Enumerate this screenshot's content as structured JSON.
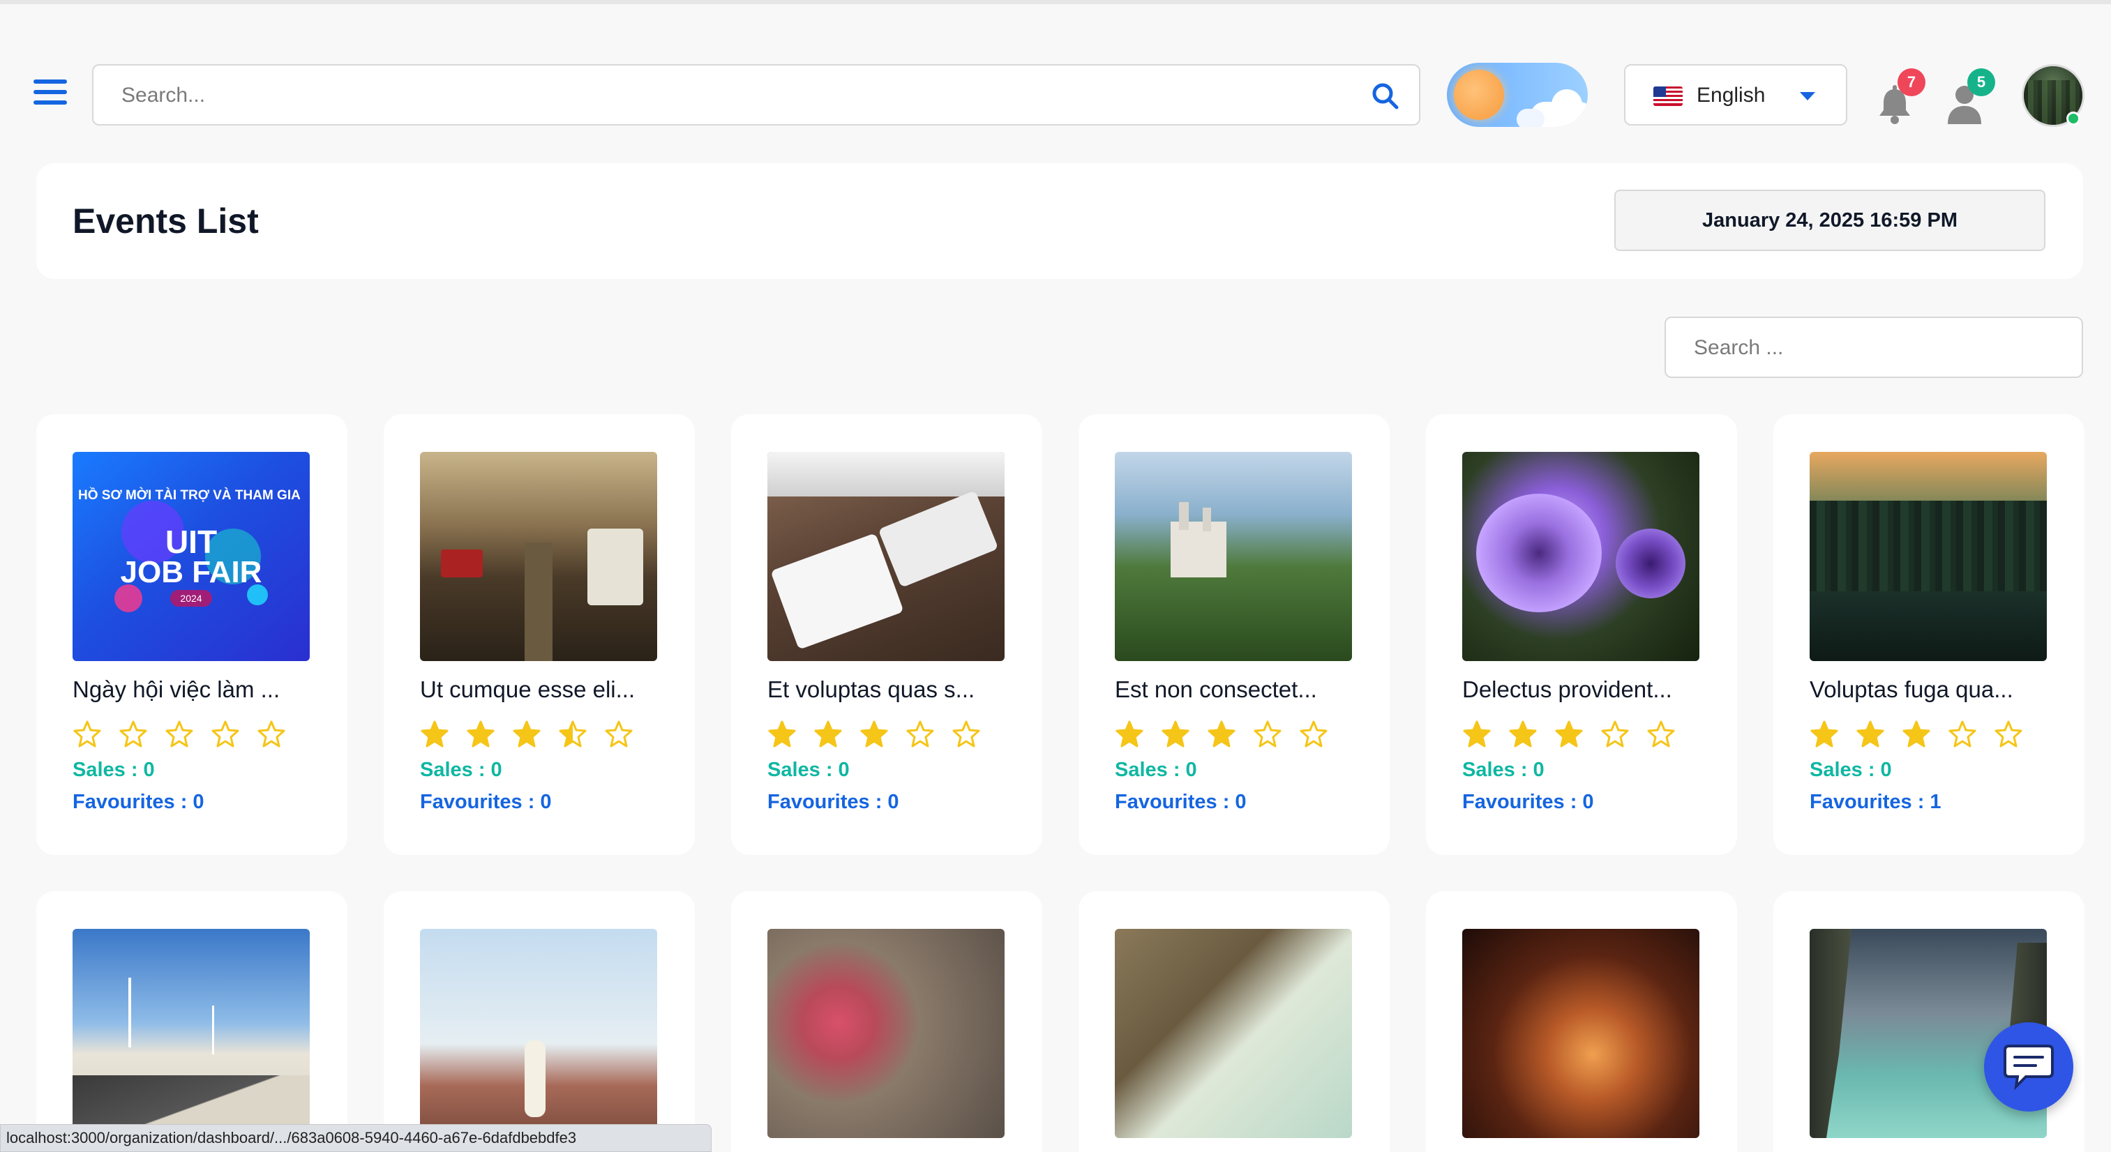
{
  "topbar": {
    "search_placeholder": "Search...",
    "language": "English",
    "notifications_count": "7",
    "users_count": "5"
  },
  "header": {
    "title": "Events List",
    "datetime": "January 24, 2025 16:59 PM"
  },
  "list_search_placeholder": "Search ...",
  "events": [
    {
      "title": "Ngày hội việc làm ...",
      "rating": 0,
      "sales": "Sales : 0",
      "favourites": "Favourites : 0",
      "image": "job-fair-banner"
    },
    {
      "title": "Ut cumque esse eli...",
      "rating": 3.5,
      "sales": "Sales : 0",
      "favourites": "Favourites : 0",
      "image": "city-street"
    },
    {
      "title": "Et voluptas quas s...",
      "rating": 3,
      "sales": "Sales : 0",
      "favourites": "Favourites : 0",
      "image": "desk-keyboard"
    },
    {
      "title": "Est non consectet...",
      "rating": 3,
      "sales": "Sales : 0",
      "favourites": "Favourites : 0",
      "image": "castle"
    },
    {
      "title": "Delectus provident...",
      "rating": 3,
      "sales": "Sales : 0",
      "favourites": "Favourites : 0",
      "image": "purple-flower"
    },
    {
      "title": "Voluptas fuga qua...",
      "rating": 3,
      "sales": "Sales : 0",
      "favourites": "Favourites : 1",
      "image": "forest-sunset"
    },
    {
      "image": "wind-turbines-road"
    },
    {
      "image": "desert-woman"
    },
    {
      "image": "macaque"
    },
    {
      "image": "architecture-arch"
    },
    {
      "image": "vaulted-corridor"
    },
    {
      "image": "sea-cliffs"
    }
  ],
  "job_fair_banner": {
    "headline": "HỒ SƠ MỜI TÀI TRỢ VÀ THAM GIA",
    "line1": "UIT",
    "line2": "JOB FAIR",
    "year": "2024"
  },
  "status_url": "localhost:3000/organization/dashboard/.../683a0608-5940-4460-a67e-6dafdbebdfe3",
  "colors": {
    "accent": "#1565e0",
    "sales": "#0fb7a2",
    "star": "#f5c518",
    "badge_red": "#f0465a",
    "badge_green": "#16b38a"
  },
  "icons": [
    "hamburger-menu-icon",
    "search-icon",
    "sun-icon",
    "us-flag-icon",
    "caret-down-icon",
    "bell-icon",
    "user-icon",
    "chat-icon",
    "star-icon"
  ]
}
